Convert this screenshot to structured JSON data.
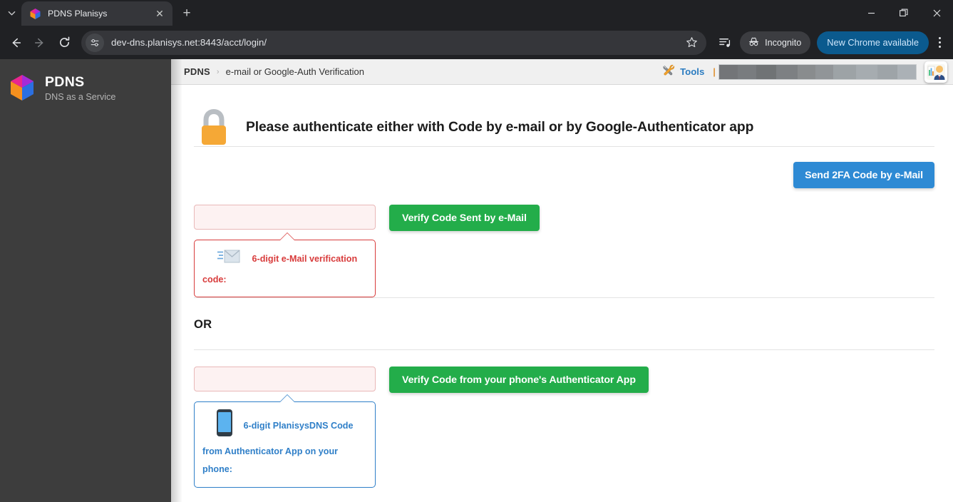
{
  "browser": {
    "tab": {
      "title": "PDNS Planisys",
      "favicon": "pdns-cube-icon",
      "close": "✕"
    },
    "tab_list_icon": "chevron-down-icon",
    "new_tab_label": "+",
    "window_controls": {
      "minimize": "–",
      "maximize": "restore-icon",
      "close": "✕"
    },
    "nav": {
      "back": "←",
      "forward": "→",
      "reload": "↻"
    },
    "omnibox": {
      "url": "dev-dns.planisys.net:8443/acct/login/",
      "site_settings_icon": "tune-icon",
      "bookmark_icon": "star-icon"
    },
    "toolbar": {
      "reading_list_icon": "reading-list-icon",
      "incognito_label": "Incognito",
      "incognito_icon": "incognito-hat-icon",
      "update_label": "New Chrome available",
      "menu_icon": "three-dot-menu-icon"
    }
  },
  "sidebar": {
    "logo_icon": "pdns-cube-icon",
    "brand_name": "PDNS",
    "brand_tagline": "DNS as a Service",
    "background_color": "#3d3d3d"
  },
  "topbar": {
    "breadcrumb": {
      "root": "PDNS",
      "separator": "›",
      "leaf": "e-mail or Google-Auth Verification"
    },
    "tools_label": "Tools",
    "tools_icon": "tools-wrench-icon",
    "tools_separator": "|",
    "redacted_field": "",
    "avatar_icon": "user-avatar-icon"
  },
  "main": {
    "lock_icon": "padlock-icon",
    "heading": "Please authenticate either with Code by e-mail or by Google-Authenticator app",
    "send_code_button": "Send 2FA Code by e-Mail",
    "email_section": {
      "input_value": "",
      "input_placeholder": "",
      "verify_button": "Verify Code Sent by e-Mail",
      "tooltip_icon": "envelope-icon",
      "tooltip_text": "6-digit e-Mail verification code:"
    },
    "or_label": "OR",
    "auth_section": {
      "input_value": "",
      "input_placeholder": "",
      "verify_button": "Verify Code from your phone's Authenticator App",
      "tooltip_icon": "smartphone-icon",
      "tooltip_text": "6-digit PlanisysDNS Code from Authenticator App on your phone:"
    }
  },
  "colors": {
    "blue_button": "#2e8ad4",
    "green_button": "#23ad4a",
    "error_red": "#d83b3b",
    "info_blue": "#2f7fc8",
    "lock_orange": "#f5a836",
    "sidebar": "#3d3d3d"
  }
}
